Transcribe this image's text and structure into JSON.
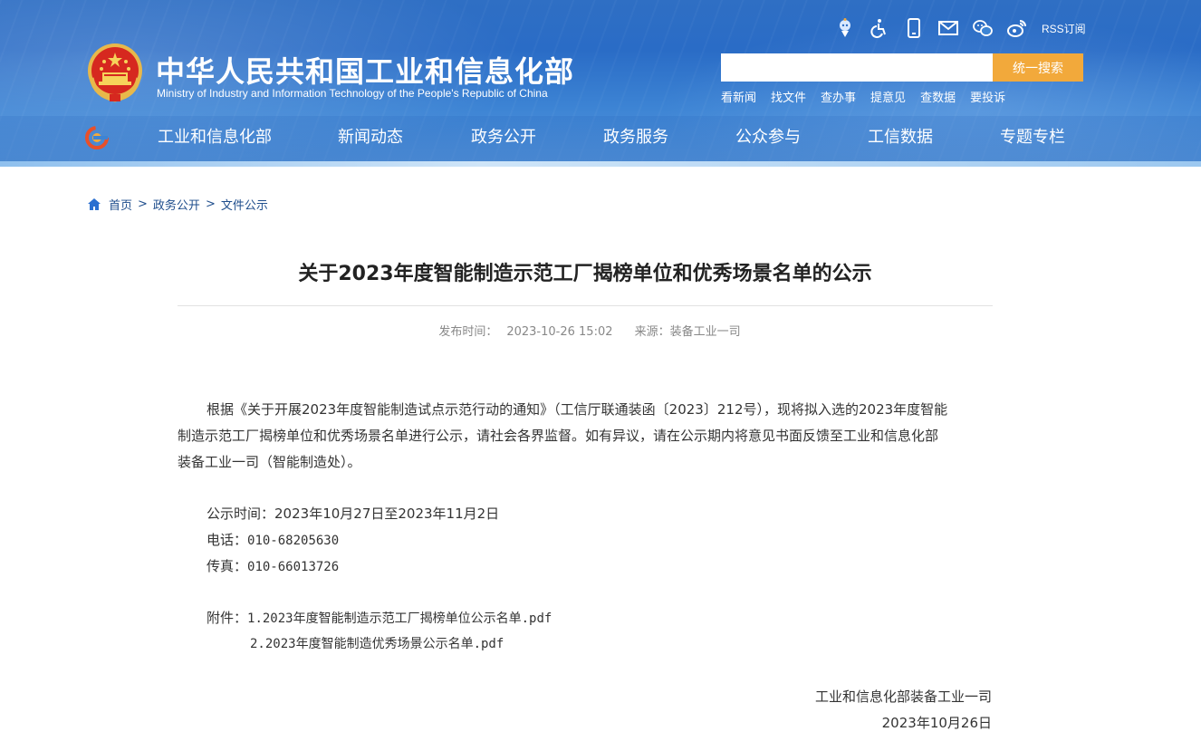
{
  "header": {
    "title": "中华人民共和国工业和信息化部",
    "subtitle": "Ministry of Industry and Information Technology of the People's Republic of China",
    "tools": [
      "robot-icon",
      "accessibility-icon",
      "mobile-icon",
      "mail-icon",
      "wechat-icon",
      "weibo-icon"
    ],
    "rss_label": "RSS订阅",
    "search": {
      "placeholder": "",
      "button_label": "统一搜索"
    },
    "quicklinks": [
      "看新闻",
      "找文件",
      "查办事",
      "提意见",
      "查数据",
      "要投诉"
    ]
  },
  "nav": {
    "items": [
      "工业和信息化部",
      "新闻动态",
      "政务公开",
      "政务服务",
      "公众参与",
      "工信数据",
      "专题专栏"
    ]
  },
  "breadcrumb": [
    "首页",
    "政务公开",
    "文件公示"
  ],
  "article": {
    "title": "关于2023年度智能制造示范工厂揭榜单位和优秀场景名单的公示",
    "publish_label": "发布时间：",
    "publish_time": "2023-10-26 15:02",
    "source_label": "来源：",
    "source": "装备工业一司",
    "body_line1": "根据《关于开展2023年度智能制造试点示范行动的通知》（工信厅联通装函〔2023〕212号），现将拟入选的2023年度智能",
    "body_line2": "制造示范工厂揭榜单位和优秀场景名单进行公示，请社会各界监督。如有异议，请在公示期内将意见书面反馈至工业和信息化部",
    "body_line3": "装备工业一司（智能制造处）。",
    "period_label": "公示时间：",
    "period_value": "2023年10月27日至2023年11月2日",
    "phone_label": "电话：",
    "phone_value": "010-68205630",
    "fax_label": "传真：",
    "fax_value": "010-66013726",
    "attach_label": "附件：",
    "attachments": [
      "1.2023年度智能制造示范工厂揭榜单位公示名单.pdf",
      "2.2023年度智能制造优秀场景公示名单.pdf"
    ],
    "signature": "工业和信息化部装备工业一司",
    "sign_date": "2023年10月26日"
  },
  "colors": {
    "banner_blue": "#2f6fc4",
    "search_button": "#f2a93b",
    "breadcrumb_link": "#1e4d8c"
  }
}
